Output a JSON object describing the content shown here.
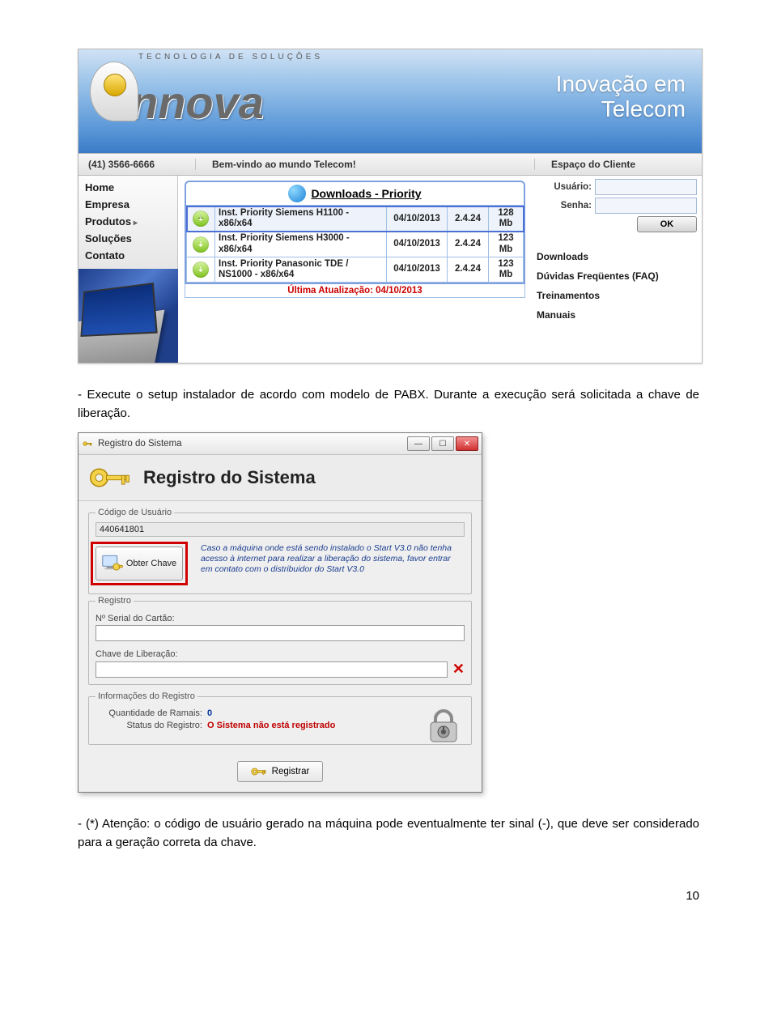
{
  "site": {
    "logo_tag": "TECNOLOGIA DE SOLUÇÕES",
    "logo_word": "nnova",
    "banner_line1": "Inovação em",
    "banner_line2": "Telecom",
    "phone": "(41) 3566-6666",
    "welcome": "Bem-vindo ao mundo Telecom!",
    "client_area": "Espaço do Cliente",
    "nav": [
      "Home",
      "Empresa",
      "Produtos",
      "Soluções",
      "Contato"
    ],
    "downloads_title": "Downloads - Priority",
    "downloads": [
      {
        "name": "Inst. Priority Siemens H1100 - x86/x64",
        "date": "04/10/2013",
        "version": "2.4.24",
        "size": "128 Mb",
        "selected": true
      },
      {
        "name": "Inst. Priority Siemens H3000 - x86/x64",
        "date": "04/10/2013",
        "version": "2.4.24",
        "size": "123 Mb",
        "selected": false
      },
      {
        "name": "Inst. Priority Panasonic TDE / NS1000 - x86/x64",
        "date": "04/10/2013",
        "version": "2.4.24",
        "size": "123 Mb",
        "selected": false
      }
    ],
    "downloads_footer": "Última Atualização: 04/10/2013",
    "login_user_label": "Usuário:",
    "login_pass_label": "Senha:",
    "ok_label": "OK",
    "side_links": [
      "Downloads",
      "Dúvidas Freqüentes (FAQ)",
      "Treinamentos",
      "Manuais"
    ]
  },
  "paragraph1": "- Execute o setup instalador de acordo com modelo de PABX. Durante a execução será solicitada a chave de liberação.",
  "dialog": {
    "titlebar": "Registro do Sistema",
    "header": "Registro do Sistema",
    "grp_user": "Código de Usuário",
    "user_code": "440641801",
    "obter_label": "Obter Chave",
    "obter_hint_line": "Caso a máquina onde está sendo instalado o Start V3.0 não tenha acesso à internet para realizar a liberação do sistema, favor entrar em contato com o distribuidor do Start V3.0",
    "grp_registro": "Registro",
    "serial_label": "Nº Serial do Cartão:",
    "serial_value": "",
    "chave_label": "Chave de Liberação:",
    "chave_value": "",
    "grp_info": "Informações do Registro",
    "ramais_label": "Quantidade de Ramais:",
    "ramais_value": "0",
    "status_label": "Status do Registro:",
    "status_value": "O Sistema não está registrado",
    "registrar_label": "Registrar"
  },
  "paragraph2": "- (*) Atenção: o código de usuário gerado na máquina pode eventualmente ter sinal (-), que deve ser considerado para a geração correta da chave.",
  "page_number": "10"
}
